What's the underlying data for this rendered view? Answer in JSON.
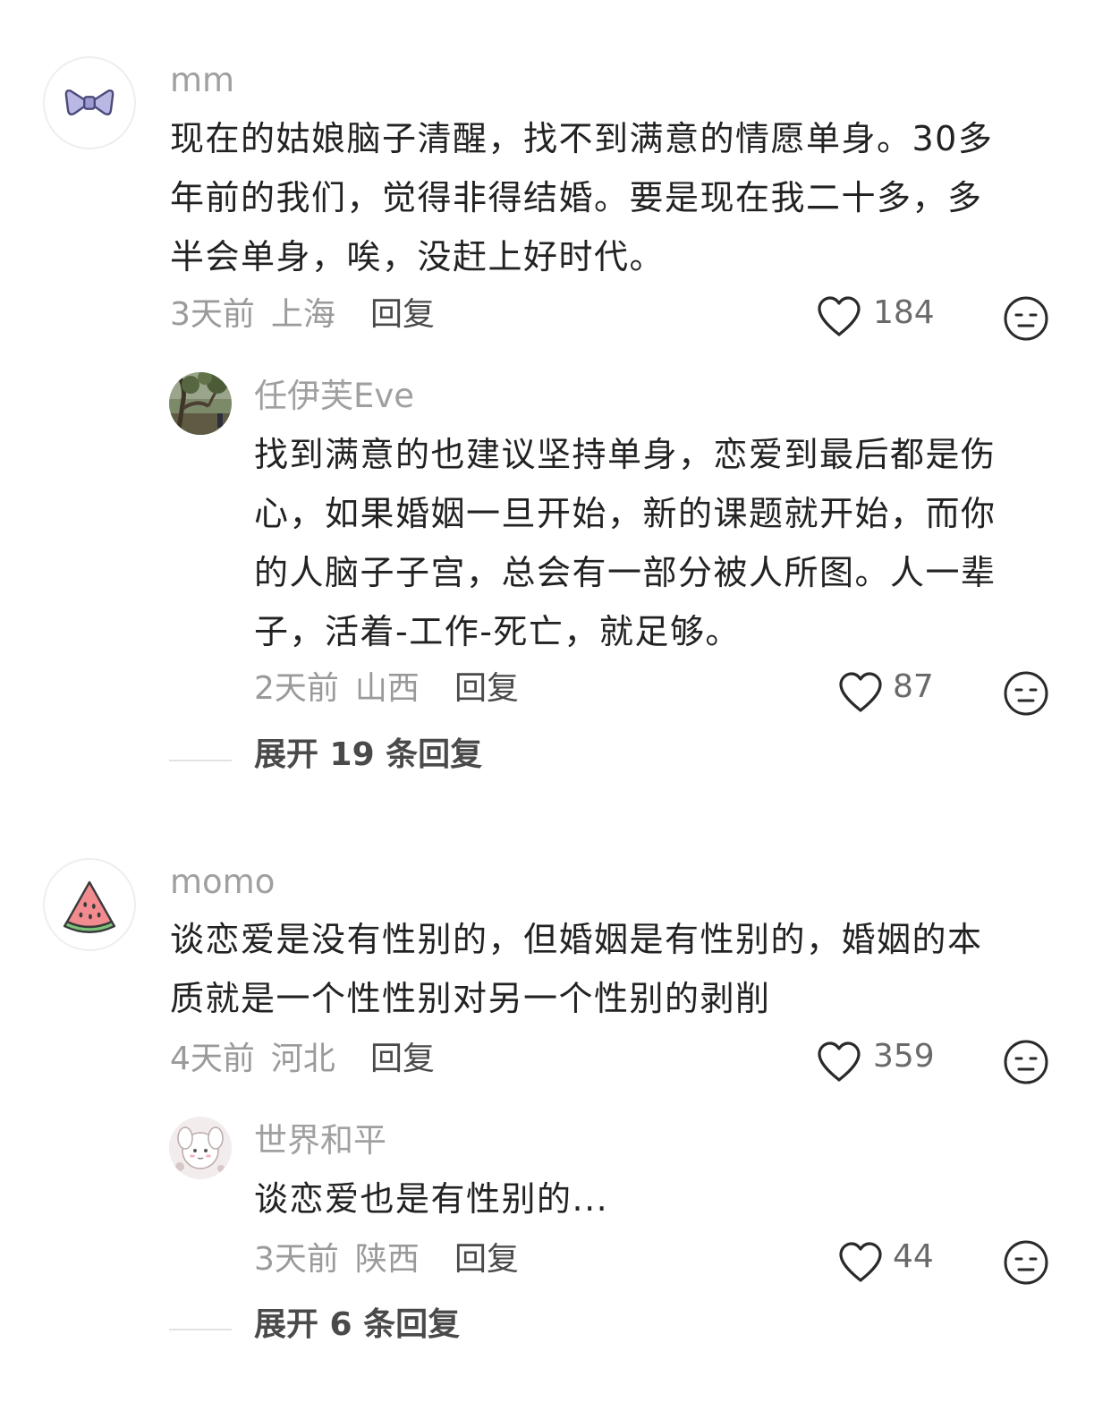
{
  "comments": [
    {
      "username": "mm",
      "avatar_icon": "bow-icon",
      "lines": [
        "现在的姑娘脑子清醒，找不到满意的情愿单身。30多",
        "年前的我们，觉得非得结婚。要是现在我二十多，多",
        "半会单身，唉，没赶上好时代。"
      ],
      "time": "3天前",
      "location": "上海",
      "reply_label": "回复",
      "likes": "184",
      "reply": {
        "username": "任伊芙Eve",
        "avatar_icon": "tree-photo-avatar",
        "lines": [
          "找到满意的也建议坚持单身，恋爱到最后都是伤",
          "心，如果婚姻一旦开始，新的课题就开始，而你",
          "的人脑子子宫，总会有一部分被人所图。人一辈",
          "子，活着-工作-死亡，就足够。"
        ],
        "time": "2天前",
        "location": "山西",
        "reply_label": "回复",
        "likes": "87"
      },
      "expand_label": "展开 19 条回复"
    },
    {
      "username": "momo",
      "avatar_icon": "watermelon-icon",
      "lines": [
        "谈恋爱是没有性别的，但婚姻是有性别的，婚姻的本",
        "质就是一个性性别对另一个性别的剥削"
      ],
      "time": "4天前",
      "location": "河北",
      "reply_label": "回复",
      "likes": "359",
      "reply": {
        "username": "世界和平",
        "avatar_icon": "cartoon-avatar",
        "lines": [
          "谈恋爱也是有性别的..."
        ],
        "time": "3天前",
        "location": "陕西",
        "reply_label": "回复",
        "likes": "44"
      },
      "expand_label": "展开 6 条回复"
    }
  ]
}
